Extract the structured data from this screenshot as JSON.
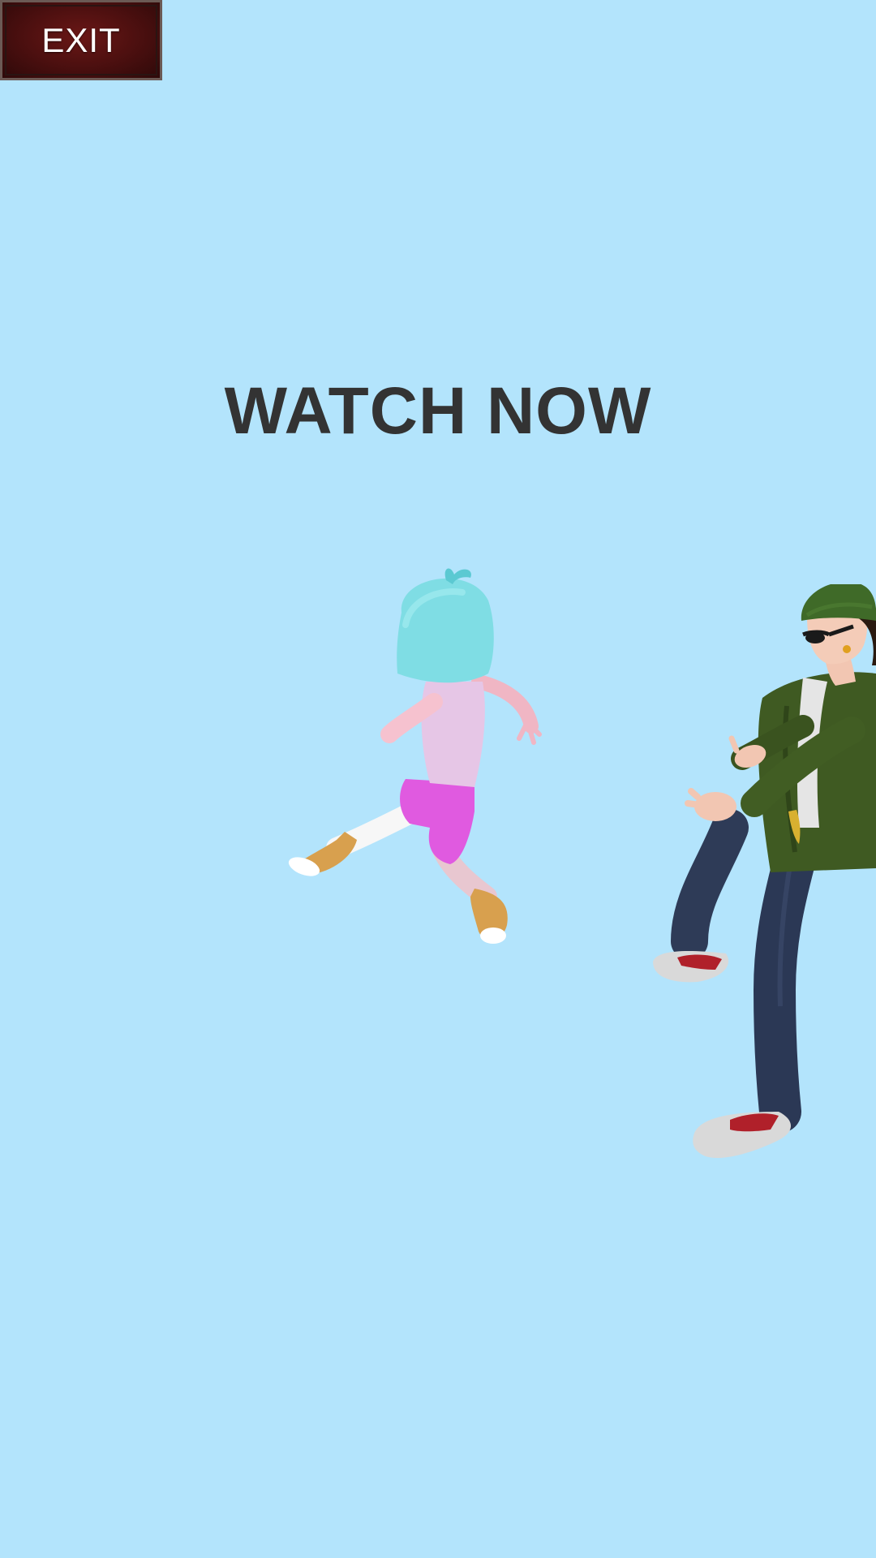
{
  "exit_button": {
    "label": "EXIT"
  },
  "prompt": {
    "title": "WATCH NOW"
  },
  "colors": {
    "background": "#b3e4fc",
    "title_text": "#333333",
    "exit_button_bg": "#4a0f0f",
    "exit_button_text": "#ffffff"
  },
  "characters": [
    {
      "name": "girl-character"
    },
    {
      "name": "boy-character"
    }
  ]
}
